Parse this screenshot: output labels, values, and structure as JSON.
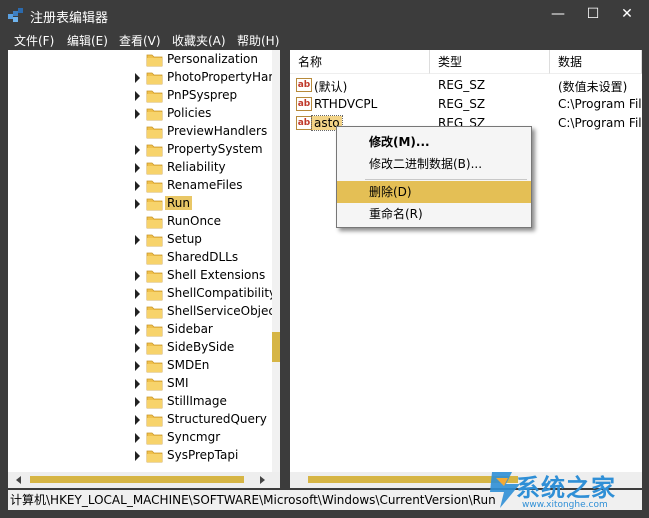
{
  "window": {
    "title": "注册表编辑器",
    "minimize": "—",
    "maximize": "☐",
    "close": "✕"
  },
  "menu": [
    "文件(F)",
    "编辑(E)",
    "查看(V)",
    "收藏夹(A)",
    "帮助(H)"
  ],
  "tree": {
    "items": [
      {
        "label": "Personalization",
        "expandable": false
      },
      {
        "label": "PhotoPropertyHan",
        "expandable": true
      },
      {
        "label": "PnPSysprep",
        "expandable": true
      },
      {
        "label": "Policies",
        "expandable": true
      },
      {
        "label": "PreviewHandlers",
        "expandable": false
      },
      {
        "label": "PropertySystem",
        "expandable": true
      },
      {
        "label": "Reliability",
        "expandable": true
      },
      {
        "label": "RenameFiles",
        "expandable": true
      },
      {
        "label": "Run",
        "expandable": true,
        "selected": true
      },
      {
        "label": "RunOnce",
        "expandable": false
      },
      {
        "label": "Setup",
        "expandable": true
      },
      {
        "label": "SharedDLLs",
        "expandable": false
      },
      {
        "label": "Shell Extensions",
        "expandable": true
      },
      {
        "label": "ShellCompatibility",
        "expandable": true
      },
      {
        "label": "ShellServiceObjectI",
        "expandable": true
      },
      {
        "label": "Sidebar",
        "expandable": true
      },
      {
        "label": "SideBySide",
        "expandable": true
      },
      {
        "label": "SMDEn",
        "expandable": true
      },
      {
        "label": "SMI",
        "expandable": true
      },
      {
        "label": "StillImage",
        "expandable": true
      },
      {
        "label": "StructuredQuery",
        "expandable": true
      },
      {
        "label": "Syncmgr",
        "expandable": true
      },
      {
        "label": "SysPrepTapi",
        "expandable": true
      }
    ]
  },
  "values": {
    "columns": {
      "name": "名称",
      "type": "类型",
      "data": "数据"
    },
    "rows": [
      {
        "name": "(默认)",
        "type": "REG_SZ",
        "data": "(数值未设置)"
      },
      {
        "name": "RTHDVCPL",
        "type": "REG_SZ",
        "data": "C:\\Program Files"
      },
      {
        "name": "asto",
        "type": "REG_SZ",
        "data": "C:\\Program Files",
        "selected": true
      }
    ],
    "icon_text": "ab"
  },
  "context_menu": {
    "items": [
      {
        "label": "修改(M)...",
        "bold": true
      },
      {
        "label": "修改二进制数据(B)..."
      },
      {
        "label": "删除(D)",
        "highlighted": true
      },
      {
        "label": "重命名(R)"
      }
    ]
  },
  "statusbar": {
    "path": "计算机\\HKEY_LOCAL_MACHINE\\SOFTWARE\\Microsoft\\Windows\\CurrentVersion\\Run"
  },
  "watermark": {
    "text": "系统之家",
    "url": "www.xitonghe.com"
  },
  "colors": {
    "selection": "#e9c766",
    "menu_highlight": "#e4bf55",
    "chrome": "#3c3c3c",
    "folder": "#f0c14b"
  }
}
